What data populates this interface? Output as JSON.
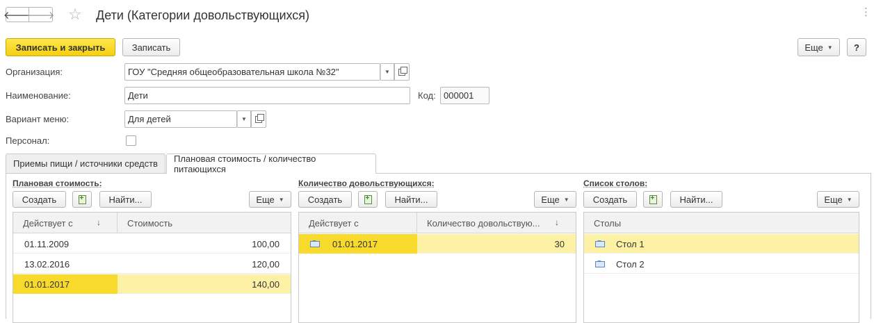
{
  "window": {
    "title": "Дети (Категории довольствующихся)",
    "back_glyph": "🡐",
    "forward_glyph": "🡒",
    "star_glyph": "☆",
    "more_glyph": "⋮"
  },
  "toolbar": {
    "save_close_label": "Записать и закрыть",
    "save_label": "Записать",
    "more_label": "Еще",
    "help_label": "?"
  },
  "form": {
    "organization_label": "Организация:",
    "organization_value": "ГОУ \"Средняя общеобразовательная школа №32\"",
    "name_label": "Наименование:",
    "name_value": "Дети",
    "code_label": "Код:",
    "code_value": "000001",
    "menu_variant_label": "Вариант меню:",
    "menu_variant_value": "Для детей",
    "personnel_label": "Персонал:",
    "personnel_checked": false
  },
  "tabs": [
    {
      "label": "Приемы пищи / источники средств",
      "active": false
    },
    {
      "label": "Плановая стоимость / количество питающихся",
      "active": true
    }
  ],
  "panels": {
    "cost": {
      "title": "Плановая стоимость:",
      "create_label": "Создать",
      "find_label": "Найти...",
      "more_label": "Еще",
      "columns": [
        "Действует с",
        "Стоимость"
      ],
      "sort_arrow": "↓",
      "rows": [
        {
          "date": "01.11.2009",
          "value": "100,00",
          "selected": false
        },
        {
          "date": "13.02.2016",
          "value": "120,00",
          "selected": false
        },
        {
          "date": "01.01.2017",
          "value": "140,00",
          "selected": true
        }
      ]
    },
    "count": {
      "title": "Количество довольствующихся:",
      "create_label": "Создать",
      "find_label": "Найти...",
      "more_label": "Еще",
      "columns": [
        "Действует с",
        "Количество довольствую..."
      ],
      "sort_arrow": "↓",
      "rows": [
        {
          "date": "01.01.2017",
          "value": "30",
          "selected": true
        }
      ]
    },
    "tables": {
      "title": "Список столов:",
      "create_label": "Создать",
      "find_label": "Найти...",
      "more_label": "Еще",
      "columns": [
        "Столы"
      ],
      "rows": [
        {
          "name": "Стол 1",
          "selected": true
        },
        {
          "name": "Стол 2",
          "selected": false
        }
      ]
    }
  },
  "colors": {
    "primary_button": "#f5cf10",
    "selected_row": "#fdf1a6",
    "selected_cell": "#f8da2c"
  }
}
